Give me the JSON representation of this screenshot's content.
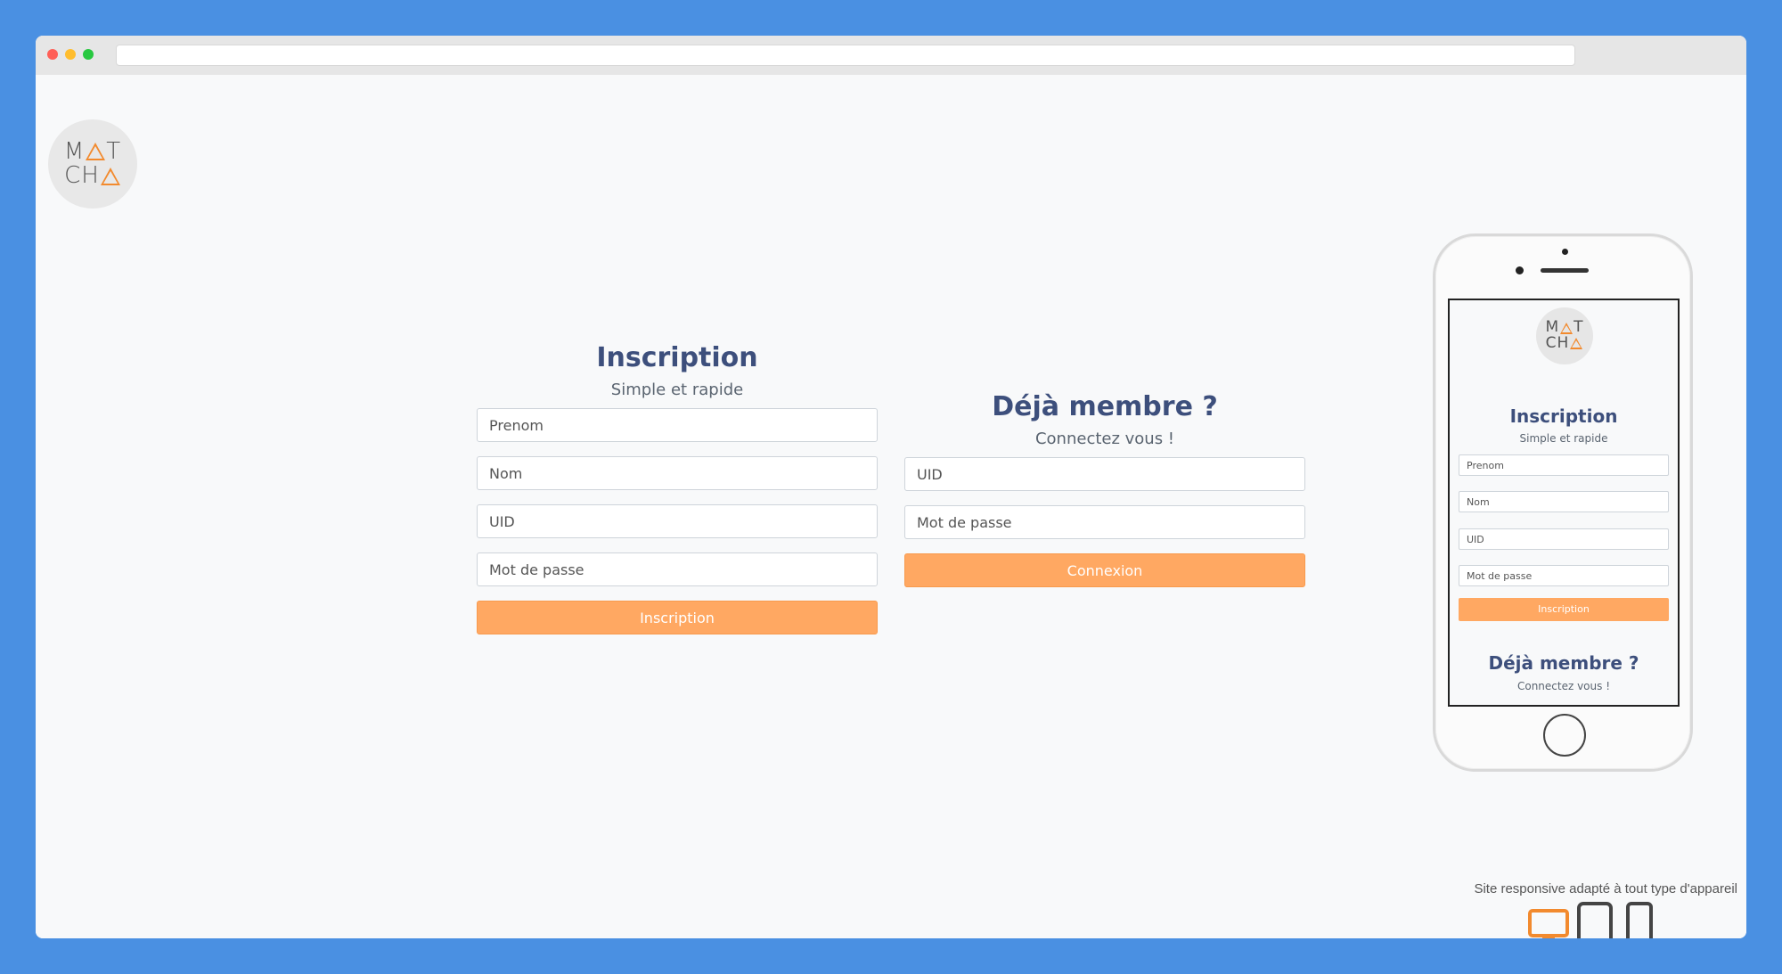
{
  "logo": {
    "line1_left": "M",
    "line1_right": "T",
    "line2_left": "CH"
  },
  "signup": {
    "title": "Inscription",
    "subtitle": "Simple et rapide",
    "fields": [
      {
        "placeholder": "Prenom"
      },
      {
        "placeholder": "Nom"
      },
      {
        "placeholder": "UID"
      },
      {
        "placeholder": "Mot de passe"
      }
    ],
    "button_label": "Inscription"
  },
  "login": {
    "title": "Déjà membre ?",
    "subtitle": "Connectez vous !",
    "fields": [
      {
        "placeholder": "UID"
      },
      {
        "placeholder": "Mot de passe"
      }
    ],
    "button_label": "Connexion"
  },
  "phone_preview": {
    "signup_title": "Inscription",
    "signup_subtitle": "Simple et rapide",
    "fields": [
      "Prenom",
      "Nom",
      "UID",
      "Mot de passe"
    ],
    "button_label": "Inscription",
    "login_title": "Déjà membre ?",
    "login_subtitle": "Connectez vous !"
  },
  "responsive_note": "Site responsive adapté à tout type d'appareil",
  "device_icons": [
    "monitor-icon",
    "tablet-icon",
    "phone-icon"
  ],
  "colors": {
    "accent": "#ffa862",
    "title": "#3d4f7c",
    "background": "#4a90e2",
    "active_device": "#f28a2e",
    "inactive_device": "#444444"
  }
}
